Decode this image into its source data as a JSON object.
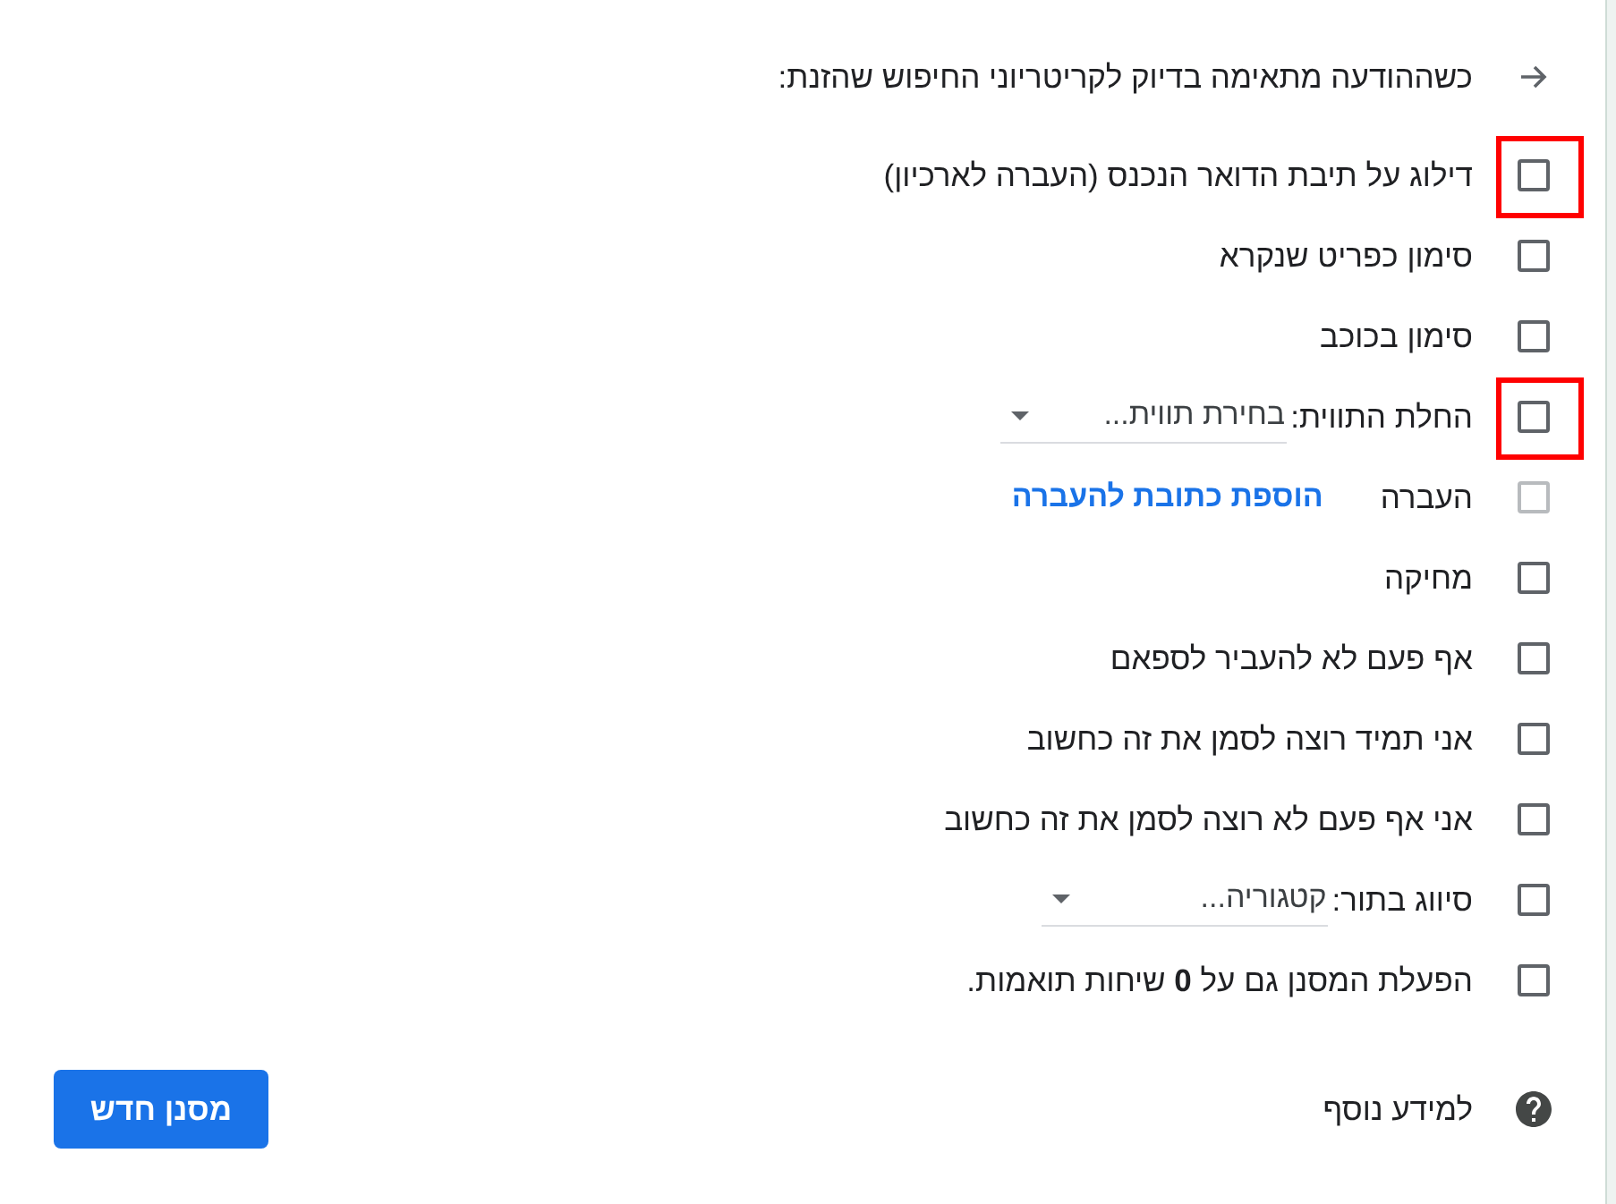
{
  "header": {
    "text": "כשההודעה מתאימה בדיוק לקריטריוני החיפוש שהזנת:"
  },
  "options": [
    {
      "kind": "plain",
      "label": "דילוג על תיבת הדואר הנכנס (העברה לארכיון)",
      "checked": false,
      "disabled": false,
      "highlighted": true
    },
    {
      "kind": "plain",
      "label": "סימון כפריט שנקרא",
      "checked": false,
      "disabled": false,
      "highlighted": false
    },
    {
      "kind": "plain",
      "label": "סימון בכוכב",
      "checked": false,
      "disabled": false,
      "highlighted": false
    },
    {
      "kind": "dropdown",
      "label": "החלת התווית:",
      "value": "בחירת תווית...",
      "checked": false,
      "disabled": false,
      "highlighted": true
    },
    {
      "kind": "link",
      "label": "העברה",
      "link": "הוספת כתובת להעברה",
      "checked": false,
      "disabled": true,
      "highlighted": false
    },
    {
      "kind": "plain",
      "label": "מחיקה",
      "checked": false,
      "disabled": false,
      "highlighted": false
    },
    {
      "kind": "plain",
      "label": "אף פעם לא להעביר לספאם",
      "checked": false,
      "disabled": false,
      "highlighted": false
    },
    {
      "kind": "plain",
      "label": "אני תמיד רוצה לסמן את זה כחשוב",
      "checked": false,
      "disabled": false,
      "highlighted": false
    },
    {
      "kind": "plain",
      "label": "אני אף פעם לא רוצה לסמן את זה כחשוב",
      "checked": false,
      "disabled": false,
      "highlighted": false
    },
    {
      "kind": "dropdown",
      "label": "סיווג בתור:",
      "value": "קטגוריה...",
      "checked": false,
      "disabled": false,
      "highlighted": false
    },
    {
      "kind": "plain",
      "label": "הפעלת המסנן גם על **0** שיחות תואמות.",
      "checked": false,
      "disabled": false,
      "highlighted": false
    }
  ],
  "help": {
    "text": "למידע נוסף"
  },
  "button": {
    "label": "מסנן חדש"
  }
}
